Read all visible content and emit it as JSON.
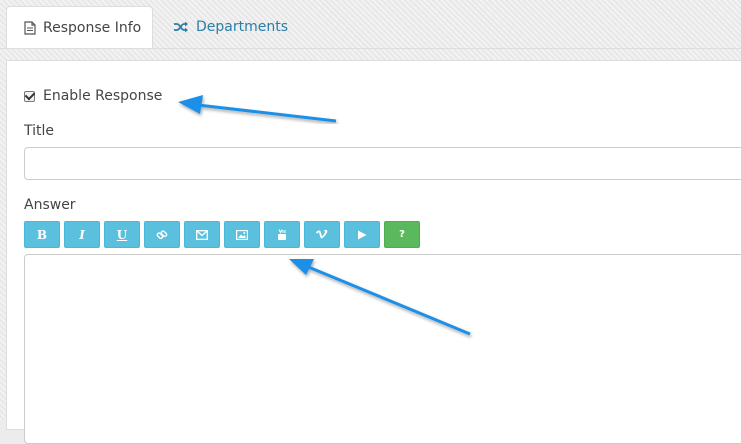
{
  "tabs": [
    {
      "label": "Response Info",
      "icon": "document-icon",
      "active": true
    },
    {
      "label": "Departments",
      "icon": "shuffle-icon",
      "active": false
    }
  ],
  "form": {
    "enable_label": "Enable Response",
    "enable_checked": true,
    "title_label": "Title",
    "title_value": "",
    "answer_label": "Answer",
    "answer_value": ""
  },
  "toolbar": {
    "bold": "B",
    "italic": "I",
    "underline": "U",
    "help": "?",
    "buttons": [
      "bold",
      "italic",
      "underline",
      "link",
      "email",
      "image",
      "youtube",
      "vimeo",
      "video",
      "help"
    ]
  },
  "colors": {
    "accent": "#5bc0de",
    "help": "#5cb85c",
    "tab_link": "#2a7ea8",
    "annotation_arrow": "#1e90e8"
  }
}
